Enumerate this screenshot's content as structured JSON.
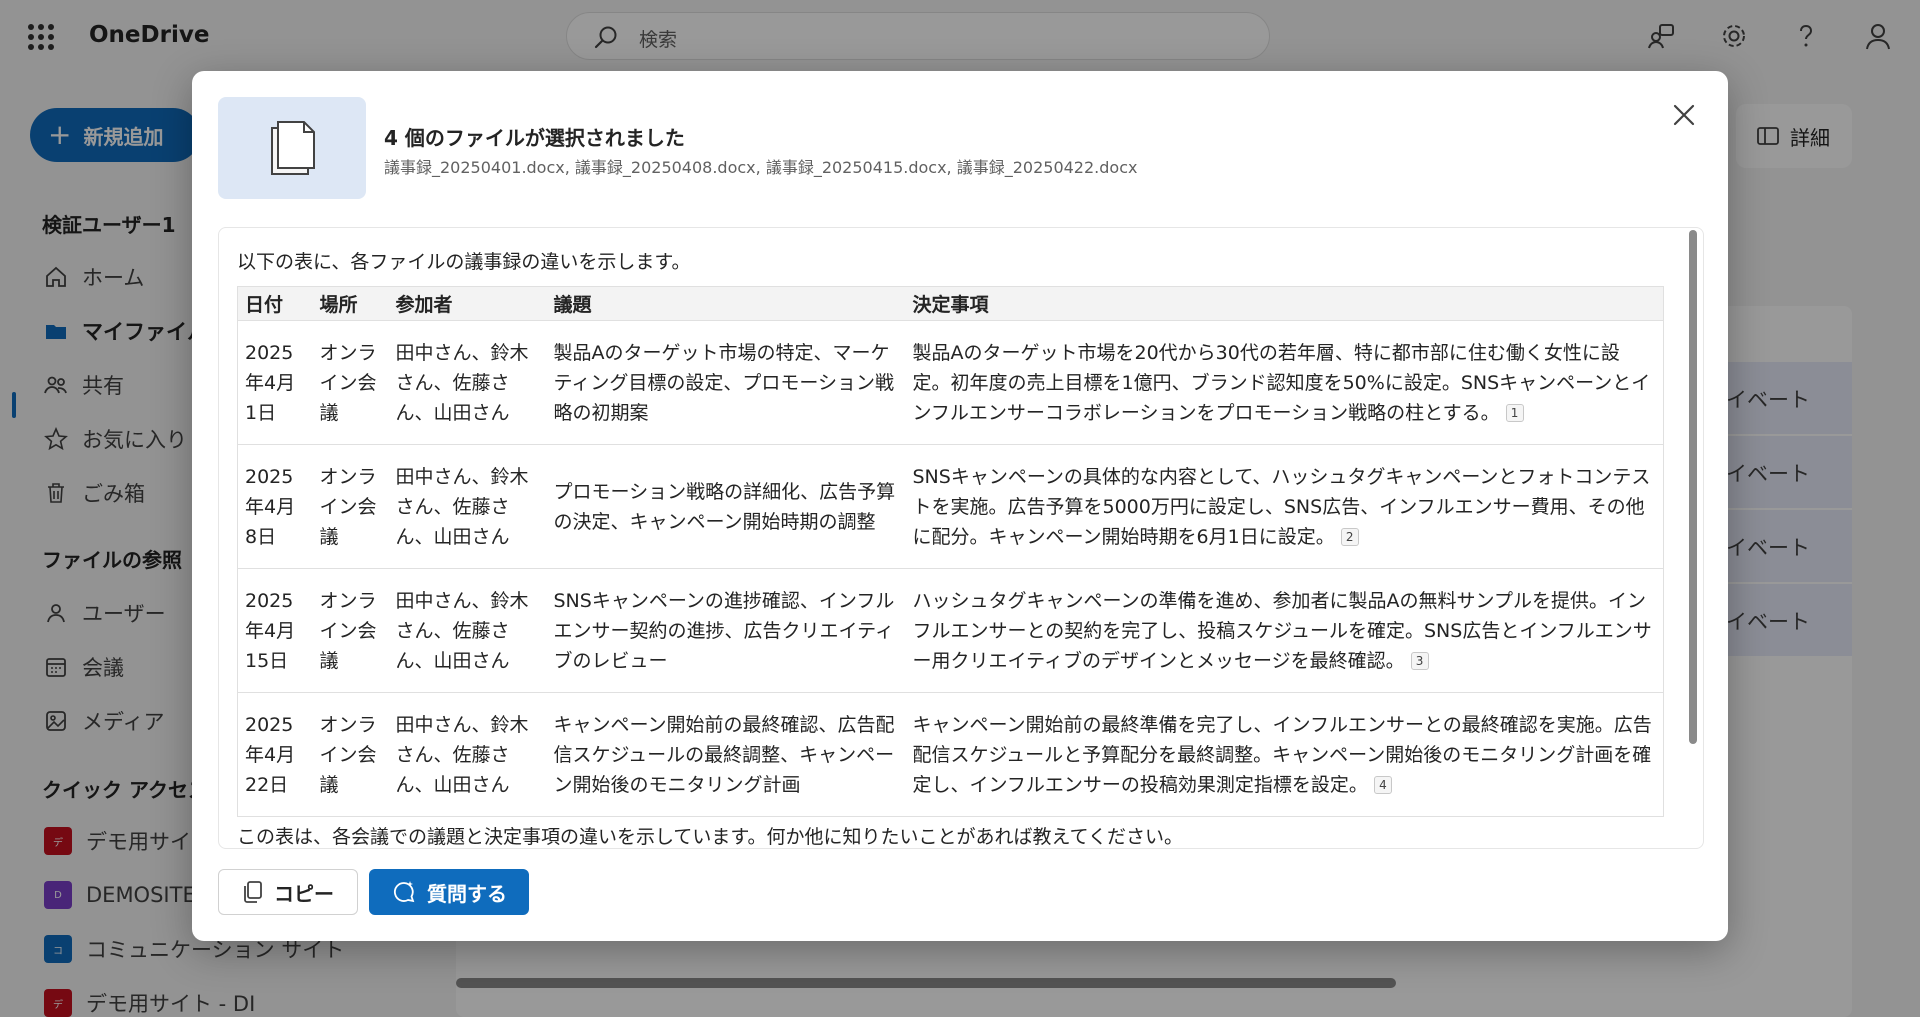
{
  "app": {
    "name": "OneDrive"
  },
  "search": {
    "placeholder": "検索"
  },
  "sidebar": {
    "new_button": "新規追加",
    "user_heading": "検証ユーザー1",
    "nav": [
      {
        "label": "ホーム"
      },
      {
        "label": "マイファイル"
      },
      {
        "label": "共有"
      },
      {
        "label": "お気に入り"
      },
      {
        "label": "ごみ箱"
      }
    ],
    "browse_heading": "ファイルの参照",
    "browse": [
      {
        "label": "ユーザー"
      },
      {
        "label": "会議"
      },
      {
        "label": "メディア"
      }
    ],
    "quick_heading": "クイック アクセス",
    "quick": [
      {
        "label": "デモ用サイト",
        "badge": "デ",
        "color": "#c50f1f"
      },
      {
        "label": "DEMOSITE",
        "badge": "D",
        "color": "#7a3fc9"
      },
      {
        "label": "コミュニケーション サイト",
        "badge": "コ",
        "color": "#0f6cbd"
      },
      {
        "label": "デモ用サイト - DI",
        "badge": "デ",
        "color": "#c50f1f"
      }
    ]
  },
  "details_button": "詳細",
  "list_rows": [
    "イベート",
    "イベート",
    "イベート",
    "イベート"
  ],
  "dialog": {
    "title": "4 個のファイルが選択されました",
    "subtitle": "議事録_20250401.docx, 議事録_20250408.docx, 議事録_20250415.docx, 議事録_20250422.docx",
    "intro": "以下の表に、各ファイルの議事録の違いを示します。",
    "table": {
      "headers": [
        "日付",
        "場所",
        "参加者",
        "議題",
        "決定事項"
      ],
      "rows": [
        {
          "date": "2025年4月1日",
          "place": "オンライン会議",
          "members": "田中さん、鈴木さん、佐藤さん、山田さん",
          "topic": "製品Aのターゲット市場の特定、マーケティング目標の設定、プロモーション戦略の初期案",
          "decision": "製品Aのターゲット市場を20代から30代の若年層、特に都市部に住む働く女性に設定。初年度の売上目標を1億円、ブランド認知度を50%に設定。SNSキャンペーンとインフルエンサーコラボレーションをプロモーション戦略の柱とする。",
          "cite": "1"
        },
        {
          "date": "2025年4月8日",
          "place": "オンライン会議",
          "members": "田中さん、鈴木さん、佐藤さん、山田さん",
          "topic": "プロモーション戦略の詳細化、広告予算の決定、キャンペーン開始時期の調整",
          "decision": "SNSキャンペーンの具体的な内容として、ハッシュタグキャンペーンとフォトコンテストを実施。広告予算を5000万円に設定し、SNS広告、インフルエンサー費用、その他に配分。キャンペーン開始時期を6月1日に設定。",
          "cite": "2"
        },
        {
          "date": "2025年4月15日",
          "place": "オンライン会議",
          "members": "田中さん、鈴木さん、佐藤さん、山田さん",
          "topic": "SNSキャンペーンの進捗確認、インフルエンサー契約の進捗、広告クリエイティブのレビュー",
          "decision": "ハッシュタグキャンペーンの準備を進め、参加者に製品Aの無料サンプルを提供。インフルエンサーとの契約を完了し、投稿スケジュールを確定。SNS広告とインフルエンサー用クリエイティブのデザインとメッセージを最終確認。",
          "cite": "3"
        },
        {
          "date": "2025年4月22日",
          "place": "オンライン会議",
          "members": "田中さん、鈴木さん、佐藤さん、山田さん",
          "topic": "キャンペーン開始前の最終確認、広告配信スケジュールの最終調整、キャンペーン開始後のモニタリング計画",
          "decision": "キャンペーン開始前の最終準備を完了し、インフルエンサーとの最終確認を実施。広告配信スケジュールと予算配分を最終調整。キャンペーン開始後のモニタリング計画を確定し、インフルエンサーの投稿効果測定指標を設定。",
          "cite": "4"
        }
      ]
    },
    "outro": "この表は、各会議での議題と決定事項の違いを示しています。何か他に知りたいことがあれば教えてください。",
    "copy_button": "コピー",
    "ask_button": "質問する"
  }
}
